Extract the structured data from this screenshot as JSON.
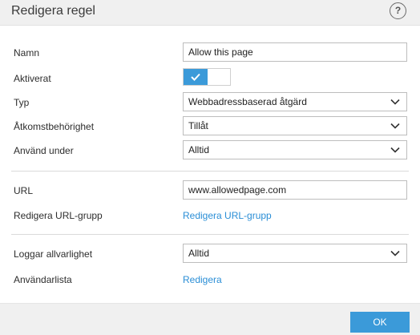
{
  "dialog": {
    "title": "Redigera regel",
    "help_symbol": "?"
  },
  "fields": {
    "name": {
      "label": "Namn",
      "value": "Allow this page"
    },
    "enabled": {
      "label": "Aktiverat",
      "state": true
    },
    "type": {
      "label": "Typ",
      "value": "Webbadressbaserad åtgärd"
    },
    "access": {
      "label": "Åtkomstbehörighet",
      "value": "Tillåt"
    },
    "apply_during": {
      "label": "Använd under",
      "value": "Alltid"
    },
    "url": {
      "label": "URL",
      "value": "www.allowedpage.com"
    },
    "url_group": {
      "label": "Redigera URL-grupp",
      "link": "Redigera URL-grupp"
    },
    "log_severity": {
      "label": "Loggar allvarlighet",
      "value": "Alltid"
    },
    "user_list": {
      "label": "Användarlista",
      "link": "Redigera"
    }
  },
  "footer": {
    "ok_label": "OK"
  },
  "colors": {
    "accent": "#3b9ad9",
    "link": "#2a8ed6",
    "chrome": "#f0f0f0"
  }
}
